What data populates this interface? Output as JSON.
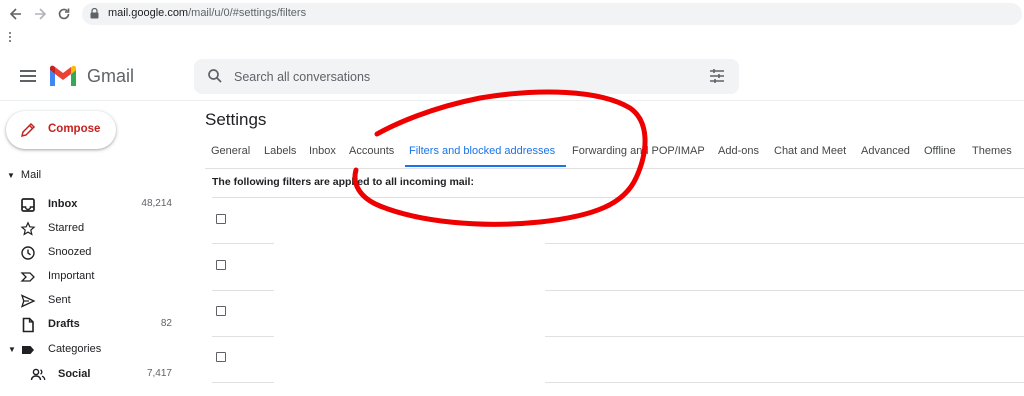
{
  "browser": {
    "url_host": "mail.google.com",
    "url_path": "/mail/u/0/#settings/filters"
  },
  "app": {
    "logo_text": "Gmail",
    "search_placeholder": "Search all conversations"
  },
  "compose": {
    "label": "Compose"
  },
  "sidebar": {
    "section_label": "Mail",
    "items": [
      {
        "label": "Inbox",
        "count": "48,214",
        "bold": true,
        "icon": "inbox-icon"
      },
      {
        "label": "Starred",
        "count": "",
        "bold": false,
        "icon": "star-icon"
      },
      {
        "label": "Snoozed",
        "count": "",
        "bold": false,
        "icon": "clock-icon"
      },
      {
        "label": "Important",
        "count": "",
        "bold": false,
        "icon": "important-icon"
      },
      {
        "label": "Sent",
        "count": "",
        "bold": false,
        "icon": "send-icon"
      },
      {
        "label": "Drafts",
        "count": "82",
        "bold": true,
        "icon": "draft-icon"
      },
      {
        "label": "Categories",
        "count": "",
        "bold": false,
        "icon": "label-icon"
      },
      {
        "label": "Social",
        "count": "7,417",
        "bold": true,
        "icon": "people-icon"
      }
    ]
  },
  "settings": {
    "title": "Settings",
    "tabs": [
      {
        "label": "General",
        "active": false
      },
      {
        "label": "Labels",
        "active": false
      },
      {
        "label": "Inbox",
        "active": false
      },
      {
        "label": "Accounts",
        "active": false
      },
      {
        "label": "Filters and blocked addresses",
        "active": true
      },
      {
        "label": "Forwarding and POP/IMAP",
        "active": false
      },
      {
        "label": "Add-ons",
        "active": false
      },
      {
        "label": "Chat and Meet",
        "active": false
      },
      {
        "label": "Advanced",
        "active": false
      },
      {
        "label": "Offline",
        "active": false
      },
      {
        "label": "Themes",
        "active": false
      }
    ],
    "filters_heading": "The following filters are applied to all incoming mail:"
  },
  "colors": {
    "accent": "#1a73e8",
    "compose_text": "#c5221f",
    "annotation": "#ee0000"
  }
}
